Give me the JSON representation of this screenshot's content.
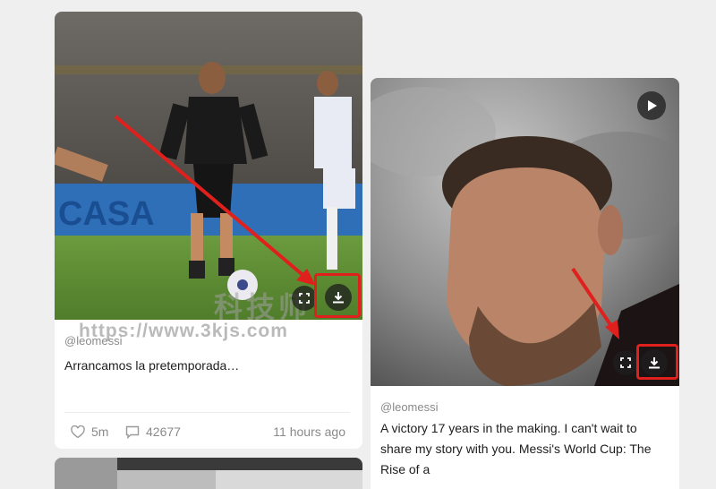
{
  "watermark": {
    "logo_text": "科技师",
    "url": "https://www.3kjs.com"
  },
  "posts": [
    {
      "handle": "@leomessi",
      "caption": "Arrancamos la pretemporada…",
      "likes": "5m",
      "comments": "42677",
      "time": "11 hours ago"
    },
    {
      "handle": "@leomessi",
      "caption": "A victory 17 years in the making. I can't wait to share my story with you. Messi's World Cup: The Rise of a"
    }
  ],
  "colors": {
    "highlight": "#e0201c",
    "arrow": "#e0201c",
    "accent": "#1d1d1d"
  },
  "icons": [
    "expand-icon",
    "download-icon",
    "play-icon",
    "heart-icon",
    "comment-icon"
  ]
}
